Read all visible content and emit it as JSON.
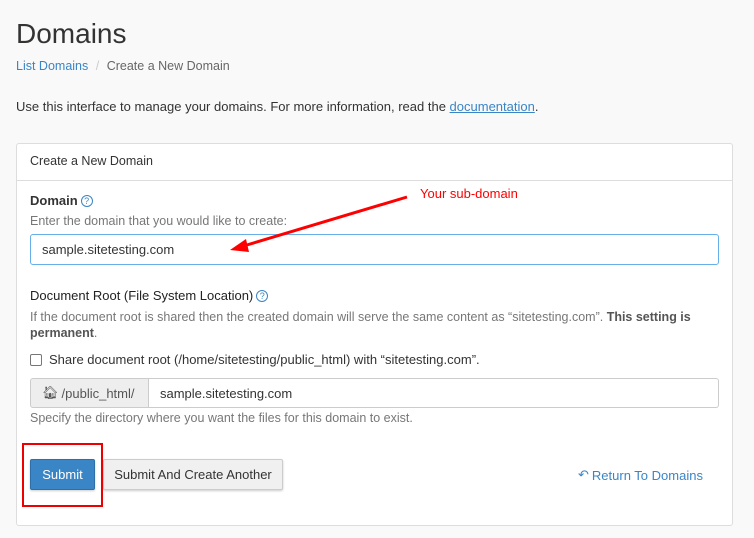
{
  "page": {
    "title": "Domains",
    "breadcrumb": [
      {
        "label": "List Domains"
      },
      {
        "label": "Create a New Domain"
      }
    ],
    "intro": "Use this interface to manage your domains. For more information, read the ",
    "intro_link": "documentation",
    "intro_end": "."
  },
  "panel": {
    "title": "Create a New Domain",
    "domain": {
      "label": "Domain",
      "help": "?",
      "hint": "Enter the domain that you would like to create:",
      "value": "sample.sitetesting.com"
    },
    "docroot": {
      "label": "Document Root (File System Location)",
      "help": "?",
      "desc": "If the document root is shared then the created domain will serve the same content as “sitetesting.com”. ",
      "desc_bold": "This setting is permanent",
      "desc_end": ".",
      "checkbox_label": "Share document root (/home/sitetesting/public_html) with “sitetesting.com”.",
      "checkbox_checked": false,
      "prefix": "/public_html/",
      "value": "sample.sitetesting.com",
      "hint": "Specify the directory where you want the files for this domain to exist."
    },
    "submit": "Submit",
    "submit_another": "Submit And Create Another",
    "return": "Return To Domains"
  },
  "annotation": {
    "text": "Your sub-domain",
    "color": "#ff0000"
  },
  "colors": {
    "primary": "#3a85c6",
    "link": "#3a85c6"
  }
}
